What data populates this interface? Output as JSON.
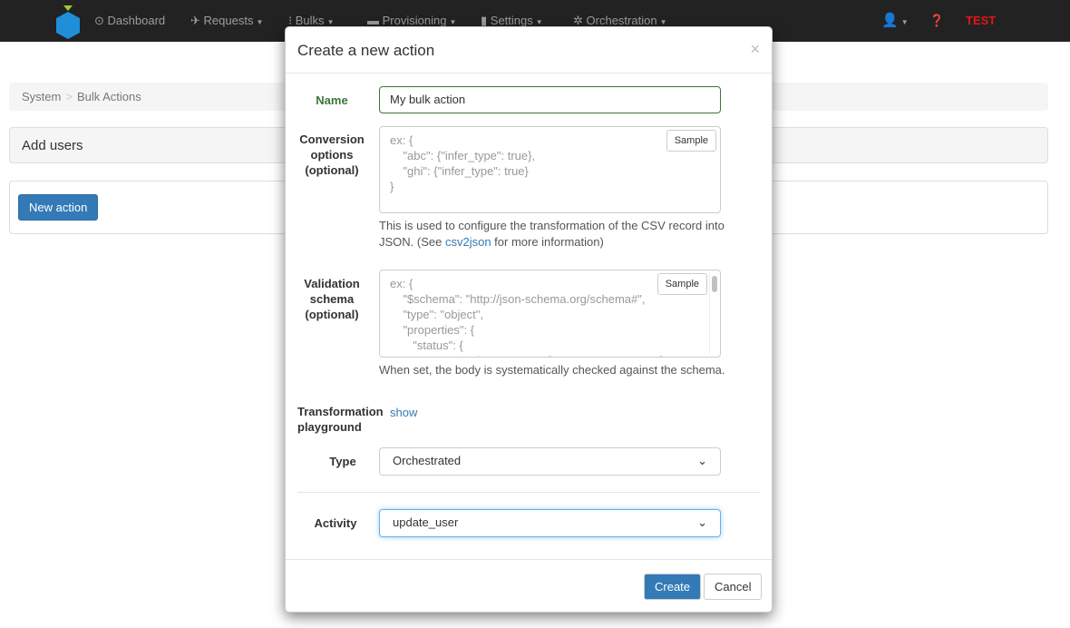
{
  "nav": {
    "items": [
      {
        "icon": "clock-icon",
        "glyph": "⊙",
        "label": "Dashboard"
      },
      {
        "icon": "send-icon",
        "glyph": "✈",
        "label": "Requests"
      },
      {
        "icon": "bulks-icon",
        "glyph": "⁝",
        "label": "Bulks"
      },
      {
        "icon": "hdd-icon",
        "glyph": "▬",
        "label": "Provisioning"
      },
      {
        "icon": "signal-icon",
        "glyph": "▮",
        "label": "Settings"
      },
      {
        "icon": "cog-icon",
        "glyph": "✲",
        "label": "Orchestration"
      }
    ],
    "env": "TEST"
  },
  "breadcrumb": [
    "System",
    "Bulk Actions"
  ],
  "panel_title": "Add users",
  "new_action": "New action",
  "modal": {
    "title": "Create a new action",
    "close": "×",
    "name_label": "Name",
    "name_value": "My bulk action",
    "conv_label": "Conversion options (optional)",
    "conv_placeholder": "ex: {\n    \"abc\": {\"infer_type\": true},\n    \"ghi\": {\"infer_type\": true}\n}",
    "sample": "Sample",
    "conv_help_1": "This is used to configure the transformation of the CSV record into JSON. (See ",
    "conv_help_link": "csv2json",
    "conv_help_2": " for more information)",
    "val_label": "Validation schema (optional)",
    "val_placeholder": "ex: {\n    \"$schema\": \"http://json-schema.org/schema#\",\n    \"type\": \"object\",\n    \"properties\": {\n       \"status\": {\n          \"type\": \"string\", \"enum\": [\"ACTIVE\", \"ERROR\"]",
    "val_help": "When set, the body is systematically checked against the schema.",
    "play_label": "Transformation playground",
    "play_link": "show",
    "type_label": "Type",
    "type_value": "Orchestrated",
    "activity_label": "Activity",
    "activity_value": "update_user",
    "create": "Create",
    "cancel": "Cancel"
  }
}
